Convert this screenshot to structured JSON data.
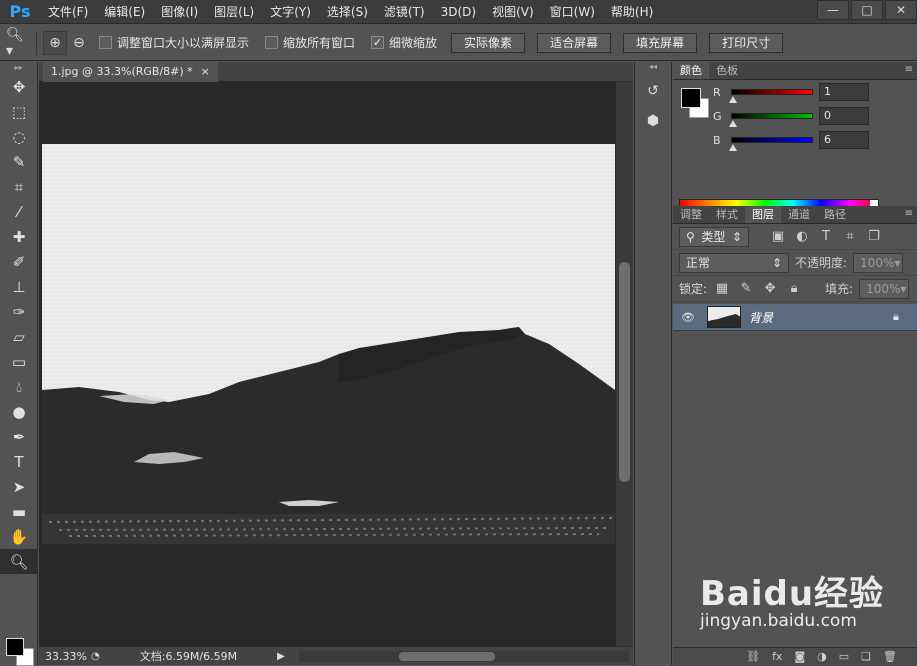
{
  "app": {
    "logo": "Ps"
  },
  "menu": [
    "文件(F)",
    "编辑(E)",
    "图像(I)",
    "图层(L)",
    "文字(Y)",
    "选择(S)",
    "滤镜(T)",
    "3D(D)",
    "视图(V)",
    "窗口(W)",
    "帮助(H)"
  ],
  "window_controls": {
    "minimize": "—",
    "maximize": "□",
    "close": "✕"
  },
  "options": {
    "checkboxes": [
      {
        "label": "调整窗口大小以满屏显示",
        "checked": false
      },
      {
        "label": "缩放所有窗口",
        "checked": false
      },
      {
        "label": "细微缩放",
        "checked": true
      }
    ],
    "buttons": [
      "实际像素",
      "适合屏幕",
      "填充屏幕",
      "打印尺寸"
    ]
  },
  "document": {
    "tab_title": "1.jpg @ 33.3%(RGB/8#) *",
    "tab_close": "×",
    "zoom": "33.33%",
    "info": "文档:6.59M/6.59M"
  },
  "color_panel": {
    "tabs": [
      "颜色",
      "色板"
    ],
    "channels": [
      {
        "label": "R",
        "value": "1",
        "color": "#ff0000"
      },
      {
        "label": "G",
        "value": "0",
        "color": "#00c000"
      },
      {
        "label": "B",
        "value": "6",
        "color": "#0000ff"
      }
    ]
  },
  "layers_panel": {
    "tabs": [
      "调整",
      "样式",
      "图层",
      "通道",
      "路径"
    ],
    "active_tab": "图层",
    "filter_label": "类型",
    "blend_mode": "正常",
    "opacity_label": "不透明度:",
    "opacity_value": "100%",
    "lock_label": "锁定:",
    "fill_label": "填充:",
    "fill_value": "100%",
    "layer_name": "背景"
  },
  "watermark": {
    "brand": "Baidu经验",
    "url": "jingyan.baidu.com"
  },
  "colors": {
    "menubar": "#3c3c3c",
    "panel": "#535353",
    "canvas_bg": "#282828",
    "selected_layer": "#5a6b80",
    "logo": "#31a8ff"
  }
}
